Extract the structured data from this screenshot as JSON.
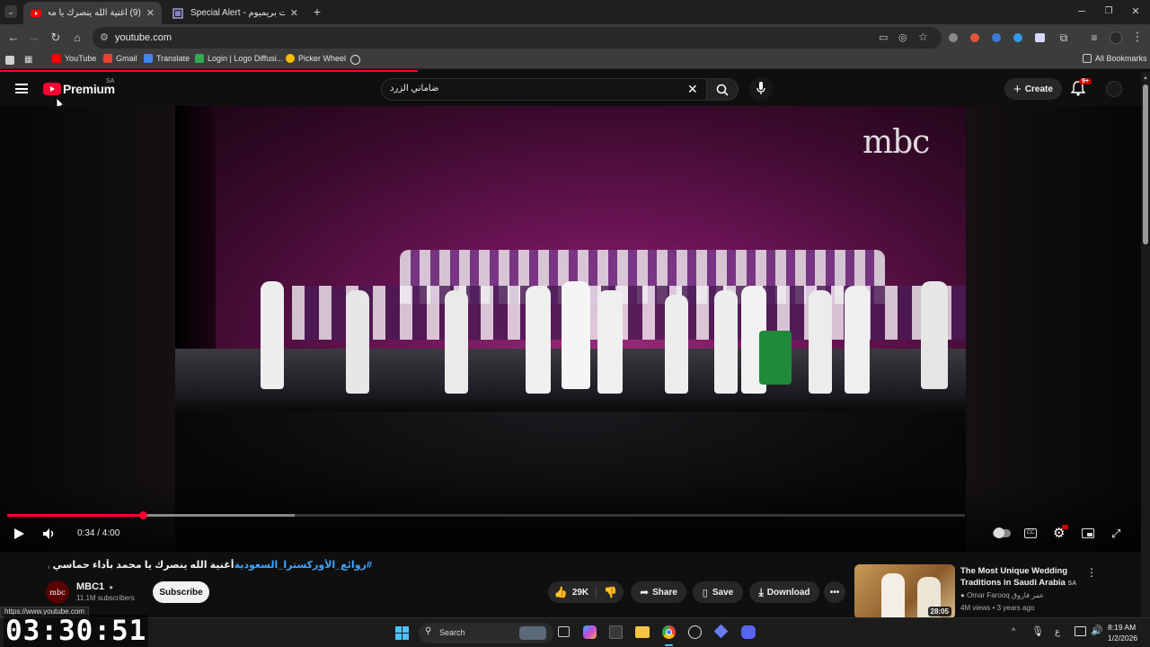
{
  "tabs": [
    {
      "title": "(9) أغنية الله ينصرك يا محمد بأداء...",
      "active": true
    },
    {
      "title": "Special Alert - الزنات بريميوم",
      "active": false
    }
  ],
  "address_bar": {
    "url": "youtube.com"
  },
  "bookmarks": [
    {
      "label": "YouTube",
      "color": "#ff0000"
    },
    {
      "label": "Gmail",
      "color": "#ea4335"
    },
    {
      "label": "Translate",
      "color": "#4285f4"
    },
    {
      "label": "Login | Logo Diffusi...",
      "color": "#34a853"
    },
    {
      "label": "Picker Wheel",
      "color": "#fbbc04"
    }
  ],
  "all_bookmarks_label": "All Bookmarks",
  "youtube": {
    "logo_text": "Premium",
    "region": "SA",
    "search_value": "ضاماني الزرد",
    "create_label": "Create",
    "notification_badge": "9+"
  },
  "video": {
    "watermark": "mbc",
    "current_time": "0:34",
    "duration": "4:00",
    "time_display": "0:34 / 4:00",
    "progress_fraction": 0.142,
    "buffered_fraction": 0.3,
    "title_tags": "#روائع_الأوركسترا_السعودية",
    "title_text": "أغنية الله ينصرك يا محمد بأداء حماسي وطربي في"
  },
  "channel": {
    "name": "MBC1",
    "subscribers": "11.1M subscribers",
    "avatar_text": "mbc",
    "subscribe_label": "Subscribe"
  },
  "actions": {
    "likes": "29K",
    "share": "Share",
    "save": "Save",
    "download": "Download"
  },
  "recommendation": {
    "title": "The Most Unique Wedding Traditions in Saudi Arabia",
    "region": "SA",
    "channel": "Omar Farooq عمر فاروق",
    "meta": "4M views • 3 years ago",
    "duration": "28:05"
  },
  "status_url": "https://www.youtube.com",
  "timer_overlay": "03:30:51",
  "taskbar": {
    "search_label": "Search",
    "time": "8:19 AM",
    "date": "1/2/2026",
    "lang": "ع"
  }
}
